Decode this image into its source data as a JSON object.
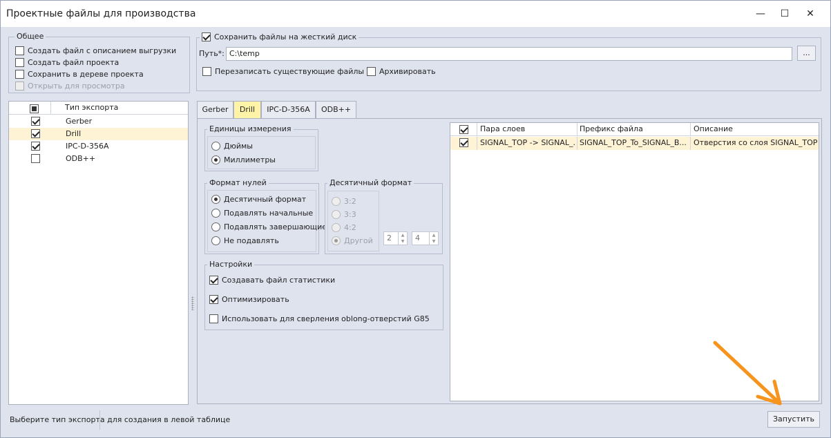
{
  "window": {
    "title": "Проектные файлы для производства",
    "minimize": "—",
    "maximize": "☐",
    "close": "✕"
  },
  "general": {
    "title": "Общее",
    "options": [
      {
        "label": "Создать файл с описанием выгрузки",
        "checked": false,
        "disabled": false
      },
      {
        "label": "Создать файл проекта",
        "checked": false,
        "disabled": false
      },
      {
        "label": "Сохранить в дереве проекта",
        "checked": false,
        "disabled": false
      },
      {
        "label": "Открыть для просмотра",
        "checked": false,
        "disabled": true
      }
    ]
  },
  "save": {
    "label": "Сохранить файлы на жесткий диск",
    "checked": true,
    "path_label": "Путь*:",
    "path_value": "C:\\temp",
    "browse_label": "...",
    "overwrite_label": "Перезаписать существующие файлы",
    "archive_label": "Архивировать"
  },
  "export_table": {
    "header": "Тип экспорта",
    "rows": [
      {
        "label": "Gerber",
        "checked": true
      },
      {
        "label": "Drill",
        "checked": true
      },
      {
        "label": "IPC-D-356A",
        "checked": true
      },
      {
        "label": "ODB++",
        "checked": false
      }
    ]
  },
  "tabs": [
    "Gerber",
    "Drill",
    "IPC-D-356A",
    "ODB++"
  ],
  "units": {
    "title": "Единицы измерения",
    "options": [
      "Дюймы",
      "Миллиметры"
    ],
    "selected": 1
  },
  "zero_format": {
    "title": "Формат нулей",
    "options": [
      "Десятичный формат",
      "Подавлять начальные",
      "Подавлять завершающие",
      "Не подавлять"
    ],
    "selected": 0
  },
  "decimal_format": {
    "title": "Десятичный формат",
    "options": [
      "3:2",
      "3:3",
      "4:2",
      "Другой"
    ],
    "selected": 3,
    "spin1": "2",
    "spin2": "4"
  },
  "settings": {
    "title": "Настройки",
    "options": [
      {
        "label": "Создавать файл статистики",
        "checked": true
      },
      {
        "label": "Оптимизировать",
        "checked": true
      },
      {
        "label": "Использовать для сверления oblong-отверстий G85",
        "checked": false
      }
    ]
  },
  "layers_table": {
    "columns": [
      "Пара слоев",
      "Префикс файла",
      "Описание"
    ],
    "rows": [
      {
        "checked": true,
        "pair": "SIGNAL_TOP -> SIGNAL_...",
        "prefix": "SIGNAL_TOP_To_SIGNAL_B...",
        "description": "Отверстия со слоя SIGNAL_TOP ..."
      }
    ]
  },
  "status": "Выберите тип экспорта для создания в левой таблице",
  "run_label": "Запустить",
  "accent_color": "#fff3a8",
  "arrow_color": "#f7941d"
}
